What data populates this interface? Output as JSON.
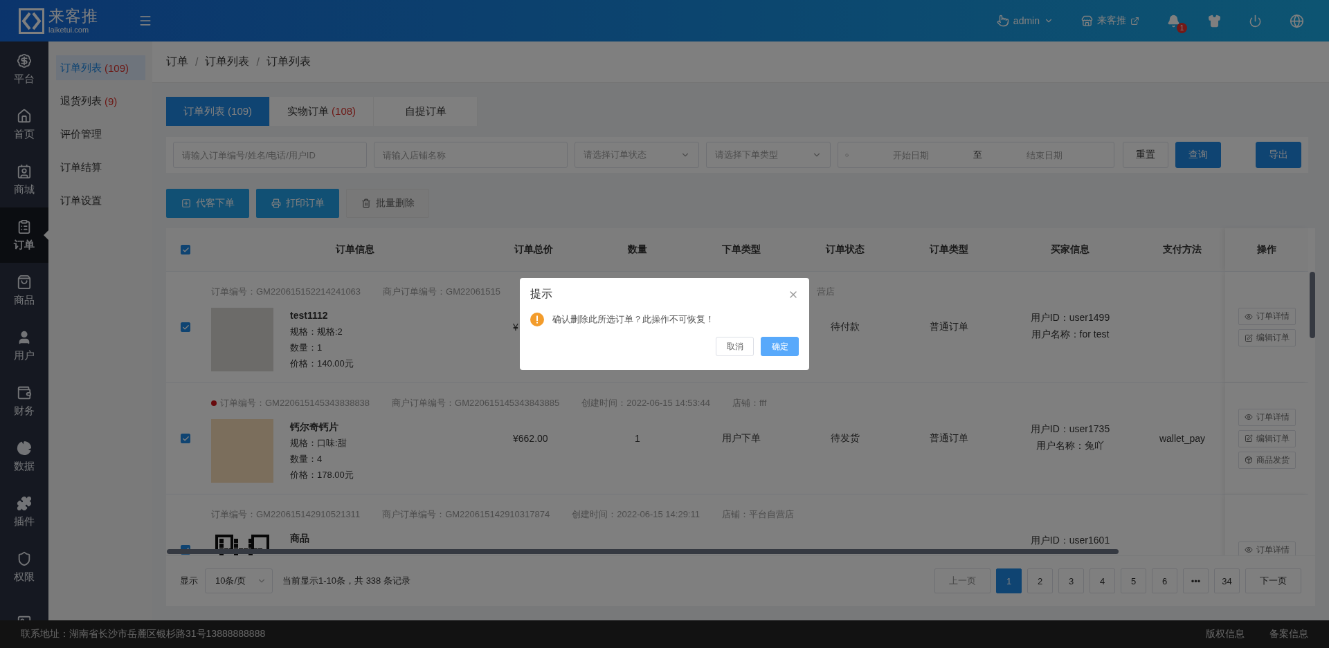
{
  "header": {
    "logo_title": "来客推",
    "logo_subtitle": "laiketui.com",
    "user": "admin",
    "store": "来客推",
    "notifications": "1"
  },
  "rail": [
    {
      "label": "平台",
      "selected": false
    },
    {
      "label": "首页",
      "selected": false
    },
    {
      "label": "商城",
      "selected": false
    },
    {
      "label": "订单",
      "selected": true
    },
    {
      "label": "商品",
      "selected": false
    },
    {
      "label": "用户",
      "selected": false
    },
    {
      "label": "财务",
      "selected": false
    },
    {
      "label": "数据",
      "selected": false
    },
    {
      "label": "插件",
      "selected": false
    },
    {
      "label": "权限",
      "selected": false
    },
    {
      "selected": false
    }
  ],
  "submenu": [
    {
      "label": "订单列表",
      "count": "(109)",
      "selected": true
    },
    {
      "label": "退货列表",
      "count": "(9)",
      "selected": false
    },
    {
      "label": "评价管理",
      "selected": false
    },
    {
      "label": "订单结算",
      "selected": false
    },
    {
      "label": "订单设置",
      "selected": false
    }
  ],
  "breadcrumb": {
    "items": [
      "订单",
      "订单列表",
      "订单列表"
    ],
    "separators": [
      "/",
      "/"
    ]
  },
  "tabs": [
    {
      "label": "订单列表",
      "count": "(109)",
      "selected": true
    },
    {
      "label": "实物订单",
      "count": "(108)",
      "selected": false
    },
    {
      "label": "自提订单",
      "selected": false
    }
  ],
  "filters": {
    "keyword_placeholder": "请输入订单编号/姓名/电话/用户ID",
    "shop_placeholder": "请输入店铺名称",
    "status_placeholder": "请选择订单状态",
    "type_placeholder": "请选择下单类型",
    "start_placeholder": "开始日期",
    "range_separator": "至",
    "end_placeholder": "结束日期",
    "reset": "重置",
    "search": "查询",
    "export": "导出"
  },
  "actions": [
    {
      "label": "代客下单",
      "kind": "add"
    },
    {
      "label": "打印订单",
      "kind": "print"
    },
    {
      "label": "批量删除",
      "kind": "delete"
    }
  ],
  "table": {
    "all_checked": true,
    "columns": [
      "订单信息",
      "订单总价",
      "数量",
      "下单类型",
      "订单状态",
      "订单类型",
      "买家信息",
      "支付方法",
      "操作"
    ],
    "rows": [
      {
        "checked": true,
        "marked": false,
        "meta": [
          {
            "label": "订单编号：",
            "value": "GM220615152214241063"
          },
          {
            "label": "商户订单编号：",
            "value": "GM22061515"
          },
          {
            "value": "营店"
          }
        ],
        "image": {
          "kind": "photo"
        },
        "product": {
          "name": "test1112",
          "lines": [
            "规格：规格:2",
            "数量：1",
            "价格：140.00元"
          ]
        },
        "price": "¥",
        "status": "待付款",
        "order_type": "普通订单",
        "buyer": [
          "用户ID：user1499",
          "用户名称：for test"
        ],
        "ops": [
          {
            "label": "订单详情",
            "kind": "view"
          },
          {
            "label": "编辑订单",
            "kind": "edit"
          }
        ]
      },
      {
        "checked": true,
        "marked": true,
        "meta": [
          {
            "label": "订单编号：",
            "value": "GM220615145343838838"
          },
          {
            "label": "商户订单编号：",
            "value": "GM220615145343843885"
          },
          {
            "label": "创建时间：",
            "value": "2022-06-15 14:53:44"
          },
          {
            "label": "店铺：",
            "value": "fff"
          }
        ],
        "image": {
          "kind": "poster"
        },
        "product": {
          "name": "钙尔奇钙片",
          "lines": [
            "规格：口味:甜",
            "数量：4",
            "价格：178.00元"
          ]
        },
        "price": "¥662.00",
        "qty": "1",
        "source": "用户下单",
        "status": "待发货",
        "order_type": "普通订单",
        "buyer": [
          "用户ID：user1735",
          "用户名称：兔吖"
        ],
        "pay": "wallet_pay",
        "ops": [
          {
            "label": "订单详情",
            "kind": "view"
          },
          {
            "label": "编辑订单",
            "kind": "edit"
          },
          {
            "label": "商品发货",
            "kind": "ship"
          }
        ]
      },
      {
        "checked": true,
        "marked": false,
        "meta": [
          {
            "label": "订单编号：",
            "value": "GM220615142910521311"
          },
          {
            "label": "商户订单编号：",
            "value": "GM220615142910317874"
          },
          {
            "label": "创建时间：",
            "value": "2022-06-15 14:29:11"
          },
          {
            "label": "店铺：",
            "value": "平台自营店"
          }
        ],
        "image": {
          "kind": "qr"
        },
        "product": {
          "name": "商品"
        },
        "buyer": [
          "用户ID：user1601"
        ],
        "ops": [
          {
            "label": "订单详情",
            "kind": "view"
          }
        ]
      }
    ]
  },
  "pagination": {
    "show_label": "显示",
    "page_size": "10条/页",
    "summary": "当前显示1-10条，共 338 条记录",
    "prev": "上一页",
    "prev_disabled": true,
    "next": "下一页",
    "pages": [
      {
        "label": "1",
        "selected": true
      },
      {
        "label": "2",
        "selected": false
      },
      {
        "label": "3",
        "selected": false
      },
      {
        "label": "4",
        "selected": false
      },
      {
        "label": "5",
        "selected": false
      },
      {
        "label": "6",
        "selected": false
      },
      {
        "label": "•••",
        "selected": false
      },
      {
        "label": "34",
        "selected": false
      }
    ]
  },
  "footer": {
    "address": "联系地址：湖南省长沙市岳麓区银杉路31号13888888888",
    "links": [
      "版权信息",
      "备案信息"
    ]
  },
  "dialog": {
    "title": "提示",
    "message": "确认删除此所选订单？此操作不可恢复！",
    "cancel": "取消",
    "confirm": "确定"
  }
}
